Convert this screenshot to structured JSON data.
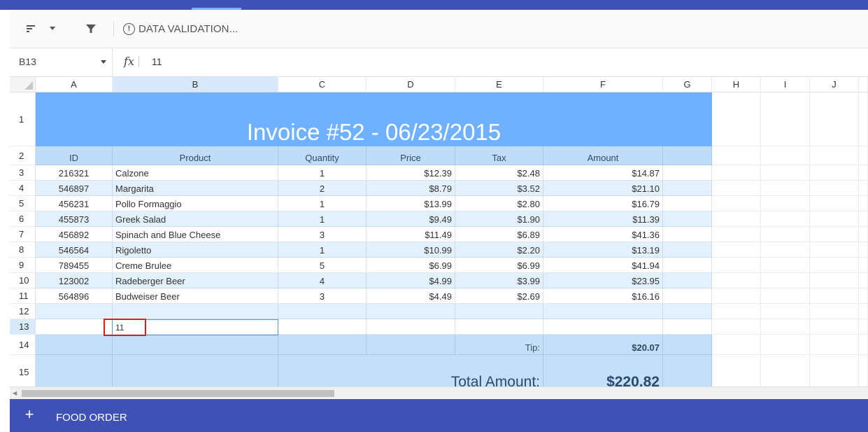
{
  "toolbar": {
    "validation_label": "DATA VALIDATION...",
    "validation_icon_glyph": "!"
  },
  "formula_bar": {
    "cell_ref": "B13",
    "fx_label": "fx",
    "value": "11"
  },
  "columns": [
    "A",
    "B",
    "C",
    "D",
    "E",
    "F",
    "G",
    "H",
    "I",
    "J"
  ],
  "rows": [
    "1",
    "2",
    "3",
    "4",
    "5",
    "6",
    "7",
    "8",
    "9",
    "10",
    "11",
    "12",
    "13",
    "14",
    "15"
  ],
  "invoice": {
    "title": "Invoice #52 - 06/23/2015",
    "headers": [
      "ID",
      "Product",
      "Quantity",
      "Price",
      "Tax",
      "Amount"
    ],
    "items": [
      [
        "216321",
        "Calzone",
        "1",
        "$12.39",
        "$2.48",
        "$14.87"
      ],
      [
        "546897",
        "Margarita",
        "2",
        "$8.79",
        "$3.52",
        "$21.10"
      ],
      [
        "456231",
        "Pollo Formaggio",
        "1",
        "$13.99",
        "$2.80",
        "$16.79"
      ],
      [
        "455873",
        "Greek Salad",
        "1",
        "$9.49",
        "$1.90",
        "$11.39"
      ],
      [
        "456892",
        "Spinach and Blue Cheese",
        "3",
        "$11.49",
        "$6.89",
        "$41.36"
      ],
      [
        "546564",
        "Rigoletto",
        "1",
        "$10.99",
        "$2.20",
        "$13.19"
      ],
      [
        "789455",
        "Creme Brulee",
        "5",
        "$6.99",
        "$6.99",
        "$41.94"
      ],
      [
        "123002",
        "Radeberger Beer",
        "4",
        "$4.99",
        "$3.99",
        "$23.95"
      ],
      [
        "564896",
        "Budweiser Beer",
        "3",
        "$4.49",
        "$2.69",
        "$16.16"
      ]
    ],
    "selected_cell_value": "11",
    "tip_label": "Tip:",
    "tip_value": "$20.07",
    "total_label": "Total Amount:",
    "total_value": "$220.82"
  },
  "sheet_tabs": {
    "add_label": "+",
    "active": "FOOD ORDER"
  },
  "colors": {
    "brand": "#3f51b5",
    "title_band": "#6fb1ff",
    "header_row": "#bfdcf8",
    "alt_row": "#e3f0fd",
    "selection_outline": "#e01b1b"
  }
}
